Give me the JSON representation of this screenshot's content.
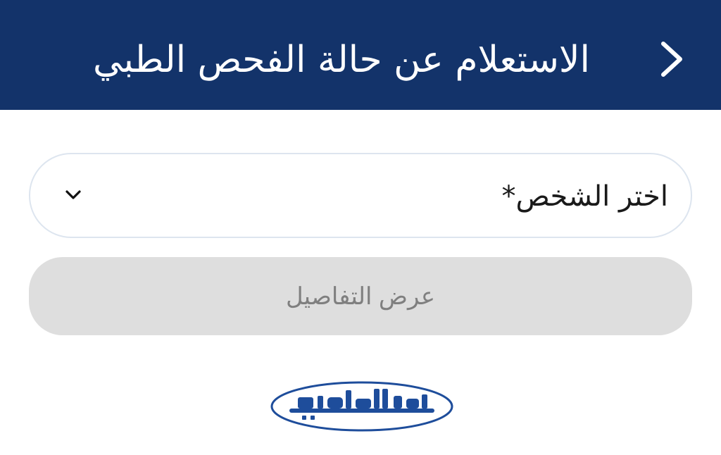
{
  "header": {
    "title": "الاستعلام عن حالة الفحص الطبي",
    "back_icon": "chevron-right-icon",
    "background_color": "#13336a"
  },
  "form": {
    "person_select": {
      "label": "اختر الشخص*",
      "value": "",
      "icon": "chevron-down-icon"
    },
    "details_button": {
      "label": "عرض التفاصيل",
      "state": "disabled"
    }
  },
  "logo": {
    "text": "رواد الكويت",
    "color": "#1e4d9b"
  }
}
